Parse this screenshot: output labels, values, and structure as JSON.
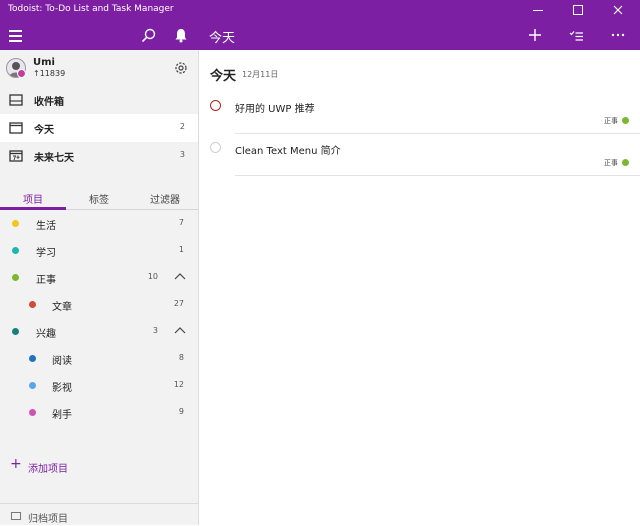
{
  "window": {
    "title": "Todoist: To-Do List and Task Manager"
  },
  "header": {
    "title": "今天"
  },
  "user": {
    "name": "Umi",
    "karma": "↑11839"
  },
  "nav": [
    {
      "label": "收件箱",
      "count": "",
      "icon": "inbox-icon"
    },
    {
      "label": "今天",
      "count": "2",
      "icon": "today-icon"
    },
    {
      "label": "未来七天",
      "count": "3",
      "icon": "next-7-days-icon"
    }
  ],
  "tabs": [
    "项目",
    "标签",
    "过滤器"
  ],
  "projects": [
    {
      "label": "生活",
      "count": "7",
      "color": "#f5c518"
    },
    {
      "label": "学习",
      "count": "1",
      "color": "#1fb5b0"
    },
    {
      "label": "正事",
      "count": "10",
      "color": "#7cb82f"
    },
    {
      "label": "文章",
      "count": "27",
      "color": "#d64a35"
    },
    {
      "label": "兴趣",
      "count": "3",
      "color": "#168080"
    },
    {
      "label": "阅读",
      "count": "8",
      "color": "#1e73be"
    },
    {
      "label": "影视",
      "count": "12",
      "color": "#5aa5e8"
    },
    {
      "label": "剁手",
      "count": "9",
      "color": "#d052b8"
    }
  ],
  "add_project_label": "添加项目",
  "archive_label": "归档项目",
  "main": {
    "title": "今天",
    "date": "12月11日",
    "tasks": [
      {
        "text": "好用的 UWP 推荐",
        "project": "正事",
        "circle_color": "#b3261e",
        "project_color": "#7cb82f"
      },
      {
        "text": "Clean Text Menu 简介",
        "project": "正事",
        "circle_color": "#cfcfcf",
        "project_color": "#7cb82f"
      }
    ]
  },
  "colors": {
    "accent": "#7c1fa3"
  }
}
